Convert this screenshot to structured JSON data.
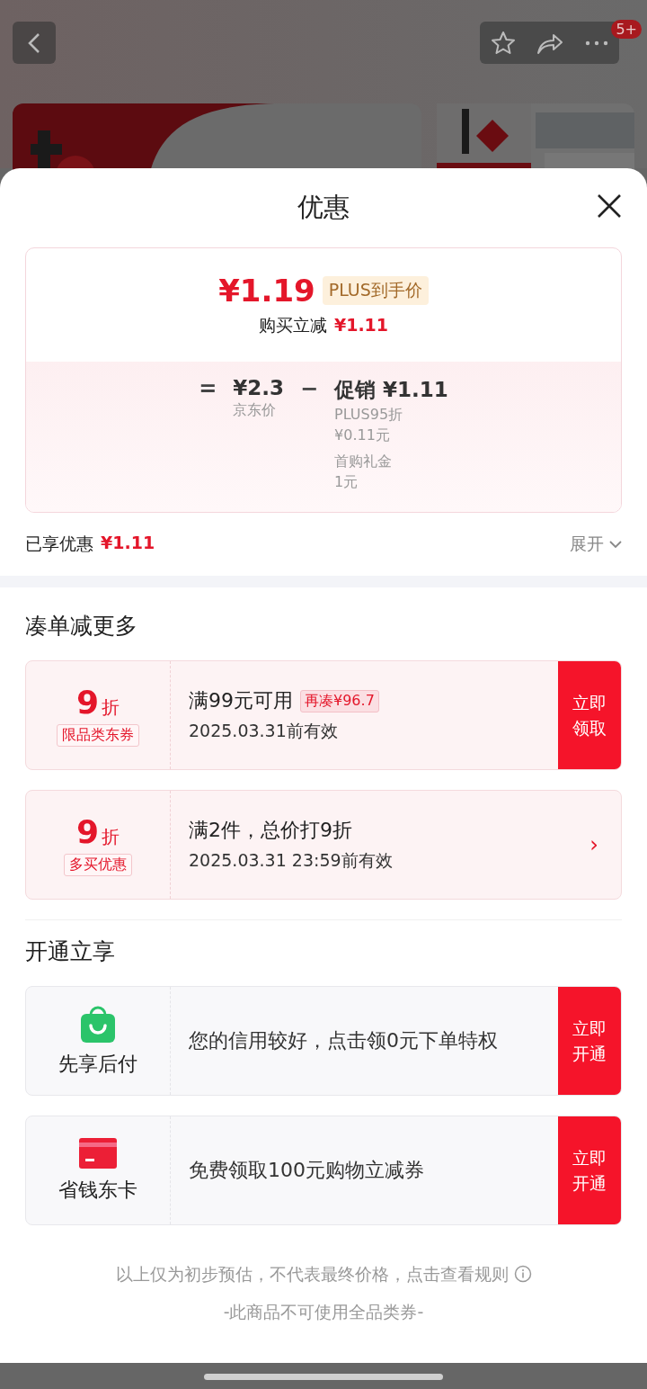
{
  "header": {
    "badge": "5+"
  },
  "sheet": {
    "title": "优惠"
  },
  "price": {
    "final": "¥1.19",
    "tag": "PLUS到手价",
    "saving_label": "购买立减",
    "saving_value": "¥1.11",
    "breakdown": {
      "equals": "=",
      "base_price": "¥2.3",
      "base_label": "京东价",
      "minus": "−",
      "promo_title": "促销 ¥1.11",
      "items": [
        {
          "name": "PLUS95折",
          "amount": "¥0.11元"
        },
        {
          "name": "首购礼金",
          "amount": "1元"
        }
      ]
    }
  },
  "summary": {
    "label": "已享优惠",
    "value": "¥1.11",
    "toggle": "展开"
  },
  "more_deals": {
    "title": "凑单减更多",
    "coupons": [
      {
        "kind": "claim",
        "discount": "9",
        "unit": "折",
        "tag": "限品类东券",
        "condition": "满99元可用",
        "hint": "再凑¥96.7",
        "validity": "2025.03.31前有效",
        "action": "立即领取"
      },
      {
        "kind": "link",
        "discount": "9",
        "unit": "折",
        "tag": "多买优惠",
        "condition": "满2件，总价打9折",
        "validity": "2025.03.31 23:59前有效",
        "action": "›"
      }
    ]
  },
  "open_now": {
    "title": "开通立享",
    "offers": [
      {
        "kind": "bag",
        "name": "先享后付",
        "text": "您的信用较好，点击领0元下单特权",
        "action": "立即开通"
      },
      {
        "kind": "card",
        "name": "省钱东卡",
        "text": "免费领取100元购物立减券",
        "action": "立即开通"
      }
    ]
  },
  "footer": {
    "disclaimer": "以上仅为初步预估，不代表最终价格，点击查看规则",
    "note": "-此商品不可使用全品类券-"
  }
}
